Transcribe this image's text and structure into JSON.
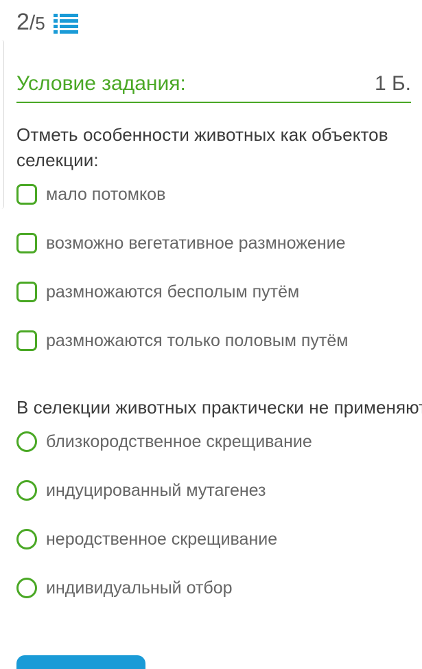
{
  "header": {
    "progress_current": "2",
    "progress_separator": "/",
    "progress_total": "5",
    "list_icon": "list-icon"
  },
  "condition": {
    "title": "Условие задания:",
    "points": "1 Б."
  },
  "question1": {
    "text": "Отметь особенности животных как объектов селекции:",
    "options": [
      "мало потомков",
      "возможно вегетативное размножение",
      "размножаются бесполым путём",
      "размножаются только половым путём"
    ]
  },
  "question2": {
    "text": "В селекции животных практически не применяют:",
    "options": [
      "близкородственное скрещивание",
      "индуцированный мутагенез",
      "неродственное скрещивание",
      "индивидуальный отбор"
    ]
  },
  "colors": {
    "accent_green": "#4aa825",
    "button_blue": "#1a9bd7"
  }
}
